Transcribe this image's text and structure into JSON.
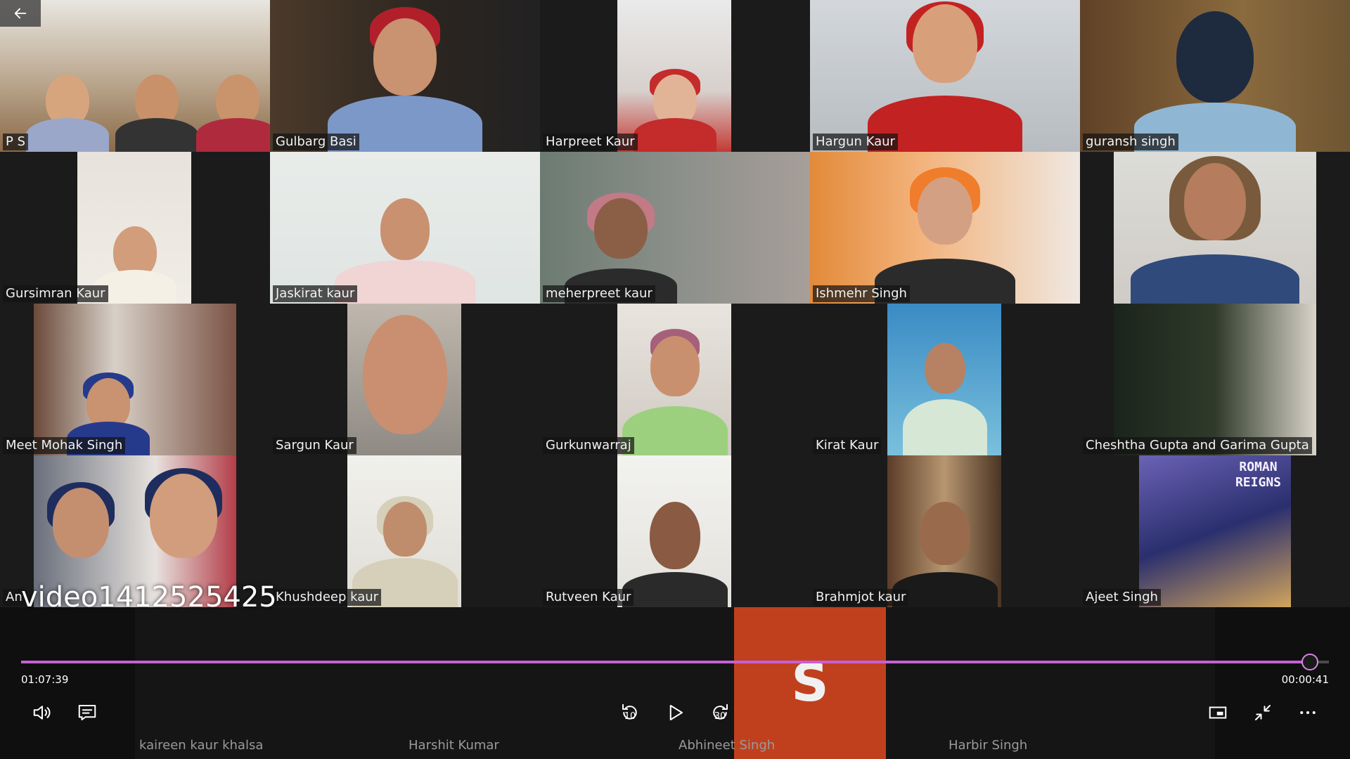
{
  "player": {
    "title": "video1412525425",
    "elapsed": "01:07:39",
    "remaining": "00:00:41",
    "progress_fraction": 0.9855,
    "accent_color": "#c65fd6",
    "skip_back_seconds": "10",
    "skip_forward_seconds": "30"
  },
  "participants": [
    {
      "name": "P S"
    },
    {
      "name": "Gulbarg Basi"
    },
    {
      "name": "Harpreet Kaur"
    },
    {
      "name": "Hargun Kaur"
    },
    {
      "name": "guransh singh"
    },
    {
      "name": "Gursimran Kaur"
    },
    {
      "name": "Jaskirat kaur"
    },
    {
      "name": "meherpreet kaur"
    },
    {
      "name": "Ishmehr Singh"
    },
    {
      "name": ""
    },
    {
      "name": "Meet Mohak Singh"
    },
    {
      "name": "Sargun Kaur"
    },
    {
      "name": "Gurkunwarraj"
    },
    {
      "name": "Kirat Kaur"
    },
    {
      "name": "Cheshtha Gupta and Garima Gupta"
    },
    {
      "name": "An"
    },
    {
      "name": "Khushdeep kaur"
    },
    {
      "name": "Rutveen Kaur"
    },
    {
      "name": "Brahmjot kaur"
    },
    {
      "name": "Ajeet Singh"
    }
  ],
  "bottom_row": {
    "names": [
      "kaireen kaur khalsa",
      "Harshit Kumar",
      "Abhineet Singh",
      "Harbir Singh"
    ],
    "avatar_letter": "S",
    "avatar_color": "#c0401e"
  },
  "poster_text": [
    "ROMAN",
    "REIGNS"
  ],
  "icons": {
    "back": "back-arrow-icon",
    "volume": "volume-icon",
    "captions": "captions-icon",
    "skip_back": "skip-back-10-icon",
    "play": "play-icon",
    "skip_forward": "skip-forward-30-icon",
    "miniview": "mini-view-icon",
    "exit_fullscreen": "exit-fullscreen-icon",
    "more": "more-options-icon"
  }
}
